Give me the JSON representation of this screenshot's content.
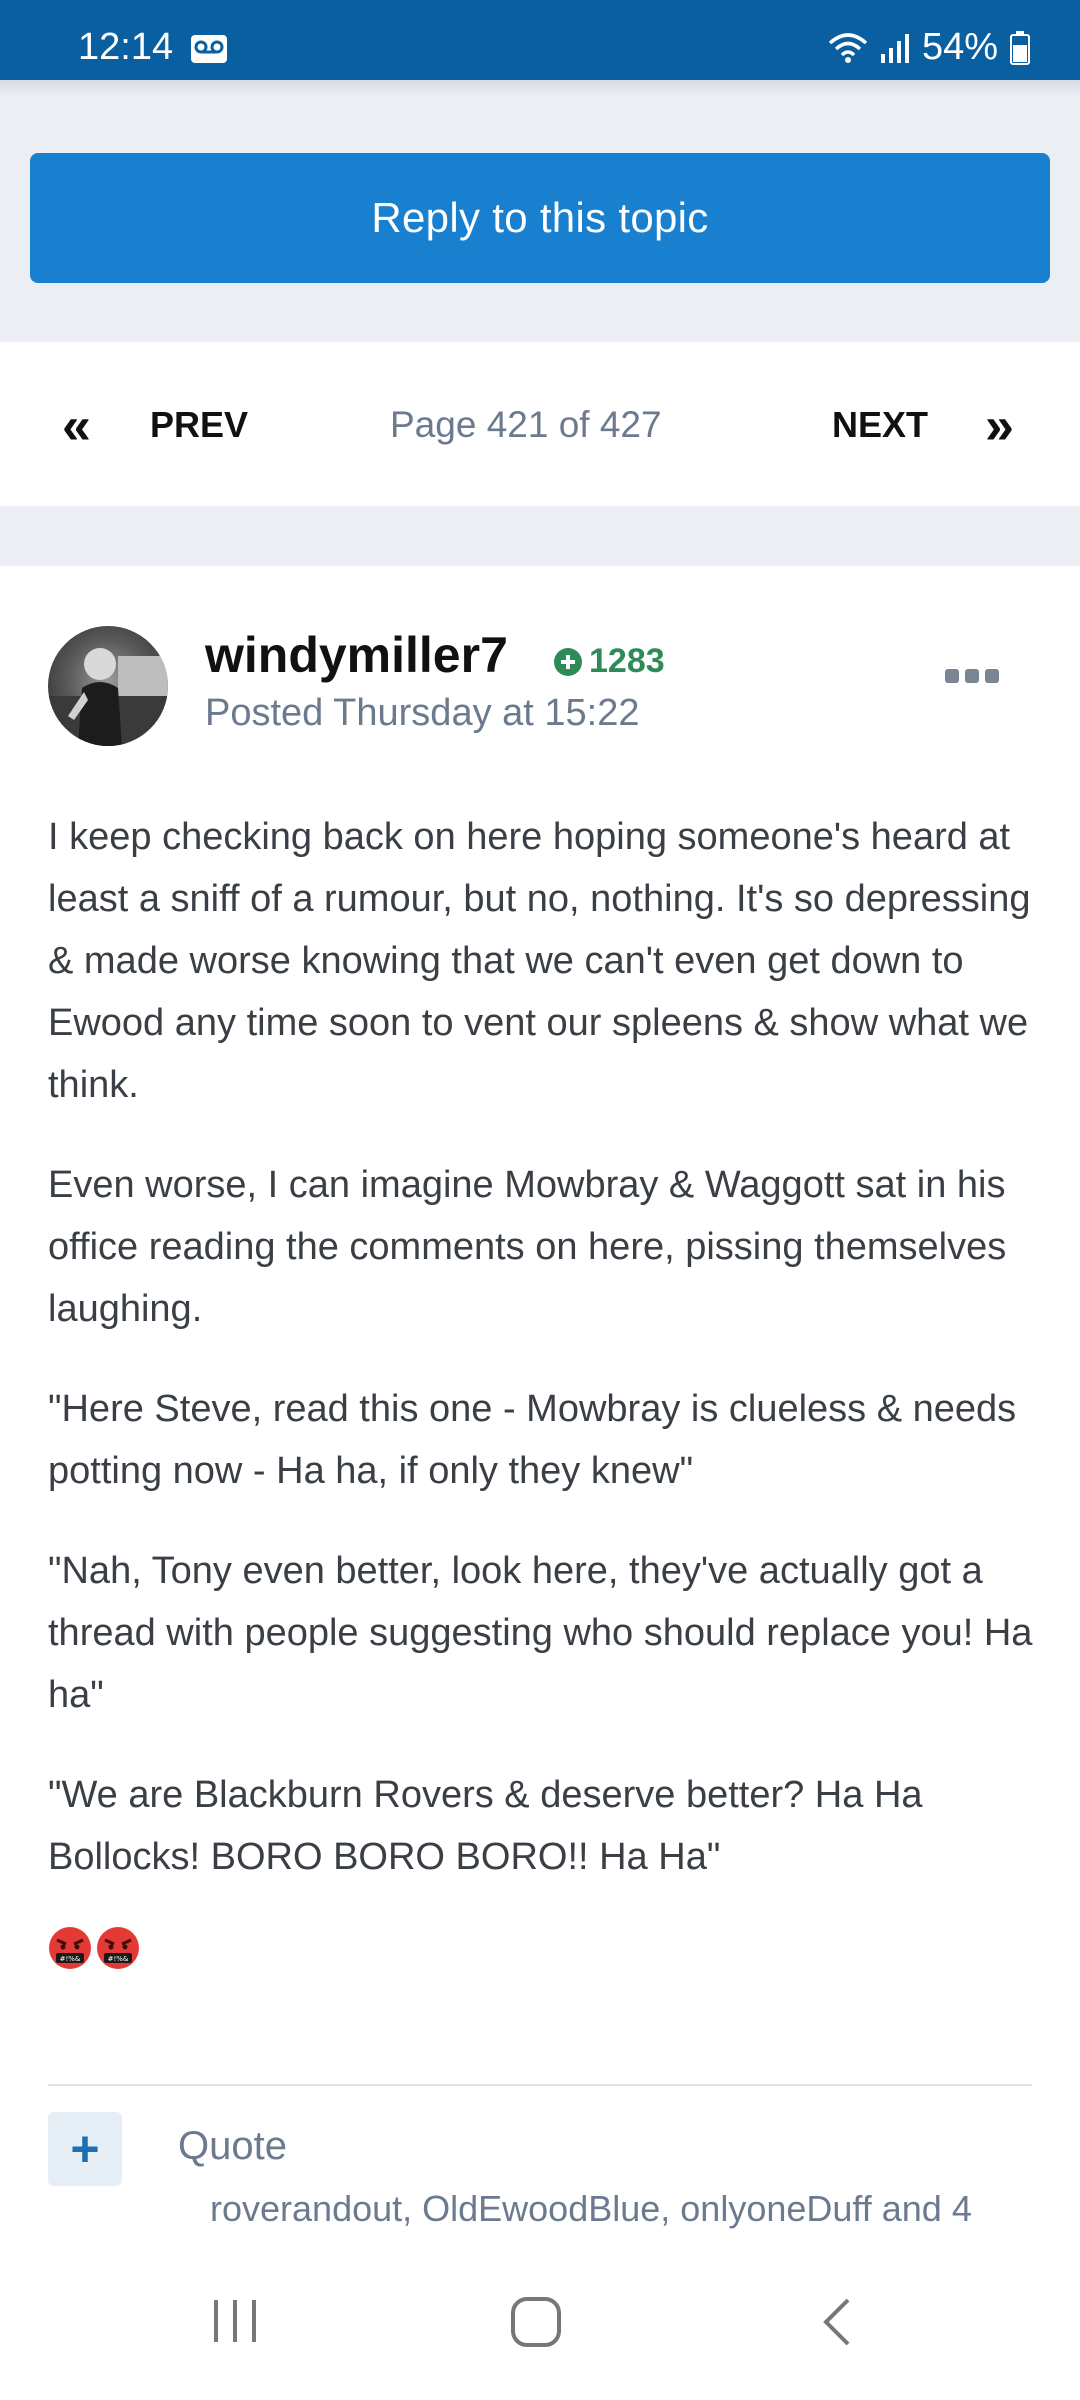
{
  "status_bar": {
    "time": "12:14",
    "battery": "54%",
    "icons": [
      "voicemail-icon",
      "wifi-icon",
      "signal-icon",
      "battery-icon"
    ]
  },
  "topic": {
    "reply_label": "Reply to this topic"
  },
  "pagination": {
    "prev_label": "PREV",
    "next_label": "NEXT",
    "page_text": "Page 421 of 427",
    "prev_icon": "«",
    "next_icon": "»"
  },
  "post": {
    "author": "windymiller7",
    "reputation": "1283",
    "posted": "Posted Thursday at 15:22",
    "paragraphs": [
      "I keep checking back on here hoping someone's heard at least a sniff of a rumour, but no, nothing. It's so depressing & made worse knowing that we can't even get down to Ewood any time soon to vent our spleens & show what we think.",
      "Even worse, I can imagine Mowbray & Waggott sat in his office reading the comments on here, pissing themselves laughing.",
      "\"Here Steve, read this one - Mowbray is clueless & needs potting now - Ha ha, if only they knew\"",
      "\"Nah, Tony even better, look here, they've actually got a thread with people suggesting who should replace you! Ha ha\"",
      "\"We are Blackburn Rovers & deserve better? Ha Ha Bollocks! BORO BORO BORO!! Ha Ha\""
    ],
    "emojis": [
      "angry-cursing-face-icon",
      "angry-cursing-face-icon"
    ],
    "quote_label": "Quote",
    "plus_label": "+",
    "likes_text": "roverandout, OldEwoodBlue, onlyoneDuff and 4"
  },
  "colors": {
    "status_bar": "#0a5fa0",
    "accent": "#1880cf",
    "reputation": "#2e8b57",
    "muted_text": "#6b7a8f",
    "page_bg": "#ebeef2"
  }
}
